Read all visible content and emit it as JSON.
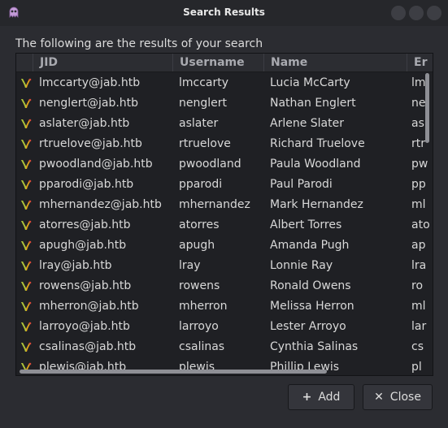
{
  "window": {
    "title": "Search Results"
  },
  "caption": "The following are the results of your search",
  "columns": [
    "JID",
    "Username",
    "Name",
    "Er"
  ],
  "rows": [
    {
      "jid": "lmccarty@jab.htb",
      "username": "lmccarty",
      "name": "Lucia McCarty",
      "email": "lm"
    },
    {
      "jid": "nenglert@jab.htb",
      "username": "nenglert",
      "name": "Nathan Englert",
      "email": "ne"
    },
    {
      "jid": "aslater@jab.htb",
      "username": "aslater",
      "name": "Arlene Slater",
      "email": "as"
    },
    {
      "jid": "rtruelove@jab.htb",
      "username": "rtruelove",
      "name": "Richard Truelove",
      "email": "rtr"
    },
    {
      "jid": "pwoodland@jab.htb",
      "username": "pwoodland",
      "name": "Paula Woodland",
      "email": "pw"
    },
    {
      "jid": "pparodi@jab.htb",
      "username": "pparodi",
      "name": "Paul Parodi",
      "email": "pp"
    },
    {
      "jid": "mhernandez@jab.htb",
      "username": "mhernandez",
      "name": "Mark Hernandez",
      "email": "ml"
    },
    {
      "jid": "atorres@jab.htb",
      "username": "atorres",
      "name": "Albert Torres",
      "email": "ato"
    },
    {
      "jid": "apugh@jab.htb",
      "username": "apugh",
      "name": "Amanda Pugh",
      "email": "ap"
    },
    {
      "jid": "lray@jab.htb",
      "username": "lray",
      "name": "Lonnie Ray",
      "email": "lra"
    },
    {
      "jid": "rowens@jab.htb",
      "username": "rowens",
      "name": "Ronald Owens",
      "email": "ro"
    },
    {
      "jid": "mherron@jab.htb",
      "username": "mherron",
      "name": "Melissa Herron",
      "email": "ml"
    },
    {
      "jid": "larroyo@jab.htb",
      "username": "larroyo",
      "name": "Lester Arroyo",
      "email": "lar"
    },
    {
      "jid": "csalinas@jab.htb",
      "username": "csalinas",
      "name": "Cynthia Salinas",
      "email": "cs"
    },
    {
      "jid": "plewis@jab.htb",
      "username": "plewis",
      "name": "Phillip Lewis",
      "email": "pl"
    }
  ],
  "buttons": {
    "add": "Add",
    "close": "Close"
  },
  "colors": {
    "background": "#2b2c31",
    "table": "#1f2024",
    "header": "#2c2d32",
    "scrollbar": "#8e8f95"
  }
}
